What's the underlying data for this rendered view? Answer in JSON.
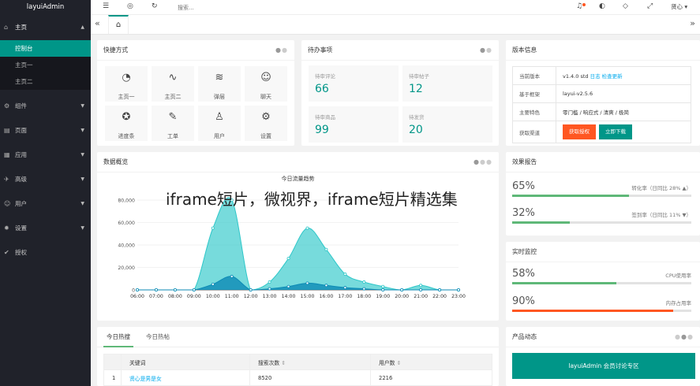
{
  "app": {
    "title": "layuiAdmin"
  },
  "sidebar": {
    "home": "主页",
    "sub": [
      "控制台",
      "主页一",
      "主页二"
    ],
    "items": [
      {
        "label": "组件",
        "icon": "gear-small-icon"
      },
      {
        "label": "页面",
        "icon": "page-icon"
      },
      {
        "label": "应用",
        "icon": "app-icon"
      },
      {
        "label": "高级",
        "icon": "senior-icon"
      },
      {
        "label": "用户",
        "icon": "user-icon"
      },
      {
        "label": "设置",
        "icon": "settings-icon"
      },
      {
        "label": "授权",
        "icon": "auth-icon"
      }
    ]
  },
  "topbar": {
    "search_placeholder": "搜索...",
    "user": "贤心"
  },
  "quick": {
    "title": "快捷方式",
    "items": [
      "主页一",
      "主页二",
      "弹层",
      "聊天",
      "进度条",
      "工单",
      "用户",
      "设置"
    ]
  },
  "todo": {
    "title": "待办事项",
    "items": [
      {
        "label": "待审评论",
        "value": "66"
      },
      {
        "label": "待审帖子",
        "value": "12"
      },
      {
        "label": "待审商品",
        "value": "99"
      },
      {
        "label": "待发货",
        "value": "20"
      }
    ]
  },
  "version": {
    "title": "版本信息",
    "rows": [
      {
        "key": "当前版本",
        "value": "v1.4.0 std",
        "links": [
          "日志",
          "检查更新"
        ]
      },
      {
        "key": "基于框架",
        "value": "layui-v2.5.6"
      },
      {
        "key": "主要特色",
        "value": "零门槛 / 响应式 / 清爽 / 极简"
      },
      {
        "key": "获取渠道",
        "btn1": "获取授权",
        "btn2": "立即下载"
      }
    ]
  },
  "overview": {
    "title": "数据概览"
  },
  "effect": {
    "title": "效果报告",
    "rows": [
      {
        "value": "65%",
        "label": "转化率（日同比 28% ▲）",
        "fill": 0.65
      },
      {
        "value": "32%",
        "label": "签到率（日同比 11% ▼）",
        "fill": 0.32
      }
    ]
  },
  "monitor": {
    "title": "实时监控",
    "rows": [
      {
        "value": "58%",
        "label": "CPU使用率",
        "fill": 0.58
      },
      {
        "value": "90%",
        "label": "内存占用率",
        "fill": 0.9
      }
    ]
  },
  "hot": {
    "tabs": [
      "今日热搜",
      "今日热帖"
    ],
    "headers": [
      "关键词",
      "搜索次数",
      "用户数"
    ],
    "rows": [
      {
        "num": "1",
        "keyword": "贤心是男是女",
        "count": "8520",
        "users": "2216"
      }
    ]
  },
  "news": {
    "title": "产品动态",
    "banner": "layuiAdmin 会员讨论专区"
  },
  "watermark": "iframe短片，微视界，iframe短片精选集",
  "chart_data": {
    "type": "area",
    "title": "今日流量趋势",
    "x": [
      "06:00",
      "07:00",
      "08:00",
      "09:00",
      "10:00",
      "11:00",
      "12:00",
      "13:00",
      "14:00",
      "15:00",
      "16:00",
      "17:00",
      "18:00",
      "19:00",
      "20:00",
      "21:00",
      "22:00",
      "23:00"
    ],
    "ylim": [
      0,
      80000
    ],
    "yticks": [
      "0",
      "20,000",
      "40,000",
      "60,000",
      "80,000"
    ],
    "series": [
      {
        "name": "",
        "color": "#2ec7c9",
        "values": [
          0,
          0,
          0,
          0,
          55000,
          80000,
          0,
          7000,
          28000,
          55000,
          36000,
          14000,
          7000,
          3000,
          0,
          4000,
          0,
          0
        ]
      },
      {
        "name": "",
        "color": "#0c8ab5",
        "values": [
          0,
          0,
          0,
          0,
          5000,
          12000,
          0,
          1000,
          3000,
          6000,
          4000,
          2000,
          1000,
          0,
          0,
          0,
          0,
          0
        ]
      }
    ]
  }
}
